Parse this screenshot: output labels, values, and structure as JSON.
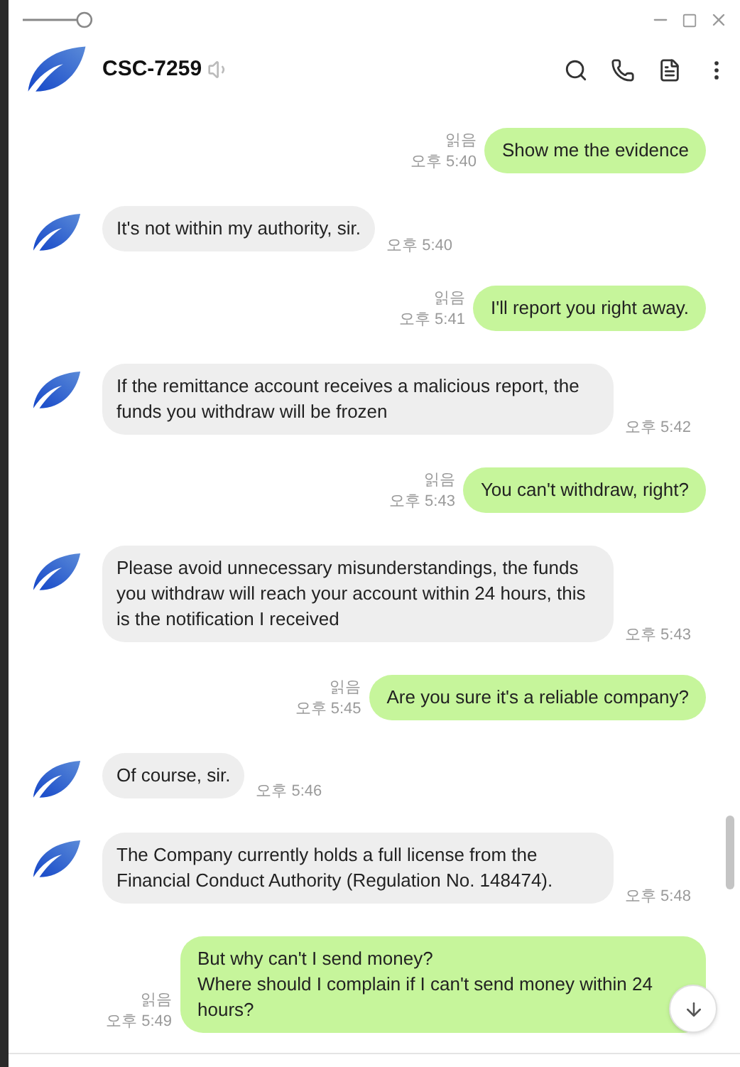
{
  "opacity_slider": {
    "level": 0.85
  },
  "header": {
    "title": "CSC-7259"
  },
  "messages": [
    {
      "kind": "sent",
      "text": "Show me the evidence",
      "read": "읽음",
      "time": "오후 5:40"
    },
    {
      "kind": "received",
      "text": "It's not within my authority, sir.",
      "time": "오후 5:40"
    },
    {
      "kind": "sent",
      "text": "I'll report you right away.",
      "read": "읽음",
      "time": "오후 5:41"
    },
    {
      "kind": "received",
      "text": "If the remittance account receives a malicious report, the funds you withdraw will be frozen",
      "time": "오후 5:42"
    },
    {
      "kind": "sent",
      "text": "You can't withdraw, right?",
      "read": "읽음",
      "time": "오후 5:43"
    },
    {
      "kind": "received",
      "text": "Please avoid unnecessary misunderstandings, the funds you withdraw will reach your account within 24 hours, this is the notification I received",
      "time": "오후 5:43"
    },
    {
      "kind": "sent",
      "text": "Are you sure it's a reliable company?",
      "read": "읽음",
      "time": "오후 5:45"
    },
    {
      "kind": "received",
      "text": "Of course, sir.",
      "time": "오후 5:46"
    },
    {
      "kind": "received",
      "text": "The Company currently holds a full license from the Financial Conduct Authority (Regulation No. 148474).",
      "time": "오후 5:48"
    },
    {
      "kind": "sent",
      "text": "But why can't I send money?\nWhere should I complain if I can't send money within 24 hours?",
      "read": "읽음",
      "time": "오후 5:49"
    }
  ]
}
